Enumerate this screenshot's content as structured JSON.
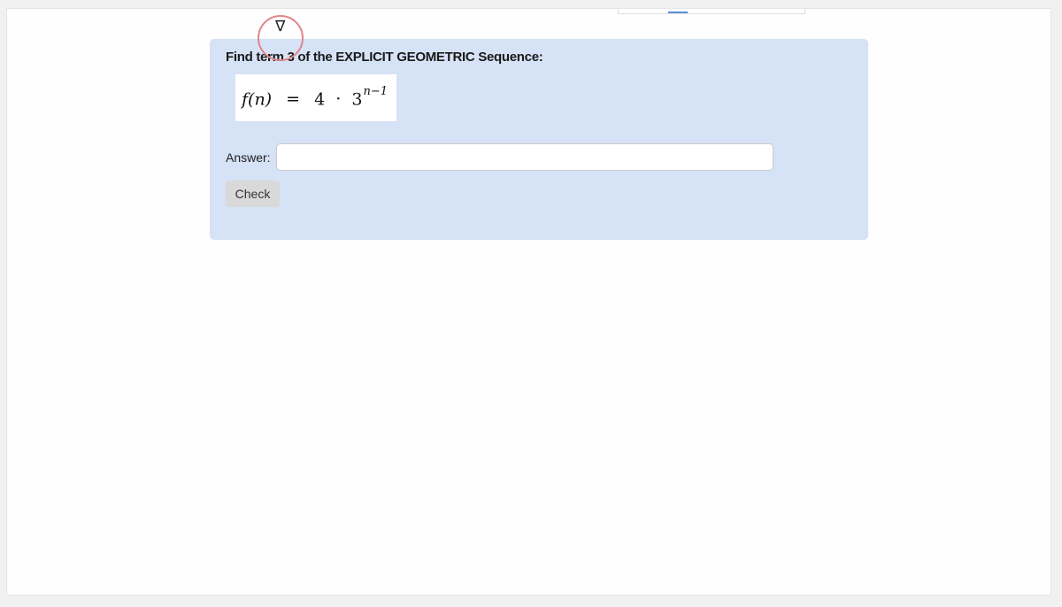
{
  "question": {
    "prompt": "Find term 3 of the EXPLICIT GEOMETRIC Sequence:",
    "formula": {
      "lhs": "f(n)",
      "equals": "=",
      "coefficient": "4",
      "operator": "·",
      "base": "3",
      "exponent": "n−1"
    }
  },
  "answer": {
    "label": "Answer:",
    "value": "",
    "placeholder": ""
  },
  "check_button": {
    "label": "Check"
  },
  "cursor": {
    "glyph": "∇"
  },
  "colors": {
    "panel_bg": "#d6e2f5",
    "cursor_ring": "#e0868a"
  }
}
